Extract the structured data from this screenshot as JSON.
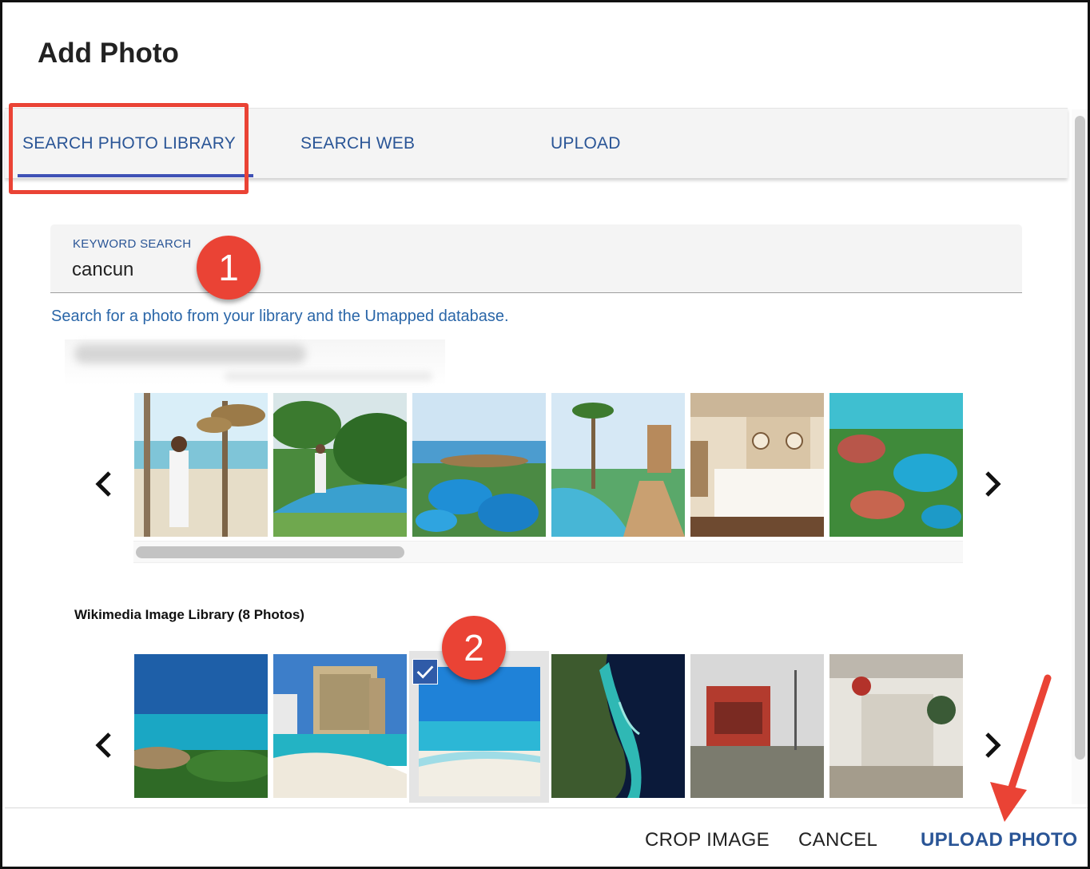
{
  "dialog": {
    "title": "Add Photo"
  },
  "tabs": [
    {
      "label": "SEARCH PHOTO LIBRARY",
      "active": true
    },
    {
      "label": "SEARCH WEB",
      "active": false
    },
    {
      "label": "UPLOAD",
      "active": false
    }
  ],
  "search": {
    "label": "KEYWORD SEARCH",
    "value": "cancun",
    "hint": "Search for a photo from your library and the Umapped database."
  },
  "callouts": {
    "one": "1",
    "two": "2"
  },
  "library_sections": [
    {
      "title": "",
      "photos": [
        "beach-man-palms",
        "resort-lazy-river",
        "resort-pools-aerial",
        "resort-pool-bridge",
        "hotel-room-bed",
        "resort-aerial-lagoon"
      ]
    },
    {
      "title": "Wikimedia Image Library (8 Photos)",
      "photos": [
        "ocean-palms-view",
        "hotel-tower-beach",
        "beach-turquoise-selected",
        "satellite-coastline",
        "storefront-storm",
        "mall-interior"
      ],
      "selected_index": 2
    }
  ],
  "footer": {
    "crop": "CROP IMAGE",
    "cancel": "CANCEL",
    "upload": "UPLOAD PHOTO"
  },
  "colors": {
    "accent": "#2a5596",
    "annotation": "#ea4335",
    "tab_indicator": "#3f51b5"
  }
}
